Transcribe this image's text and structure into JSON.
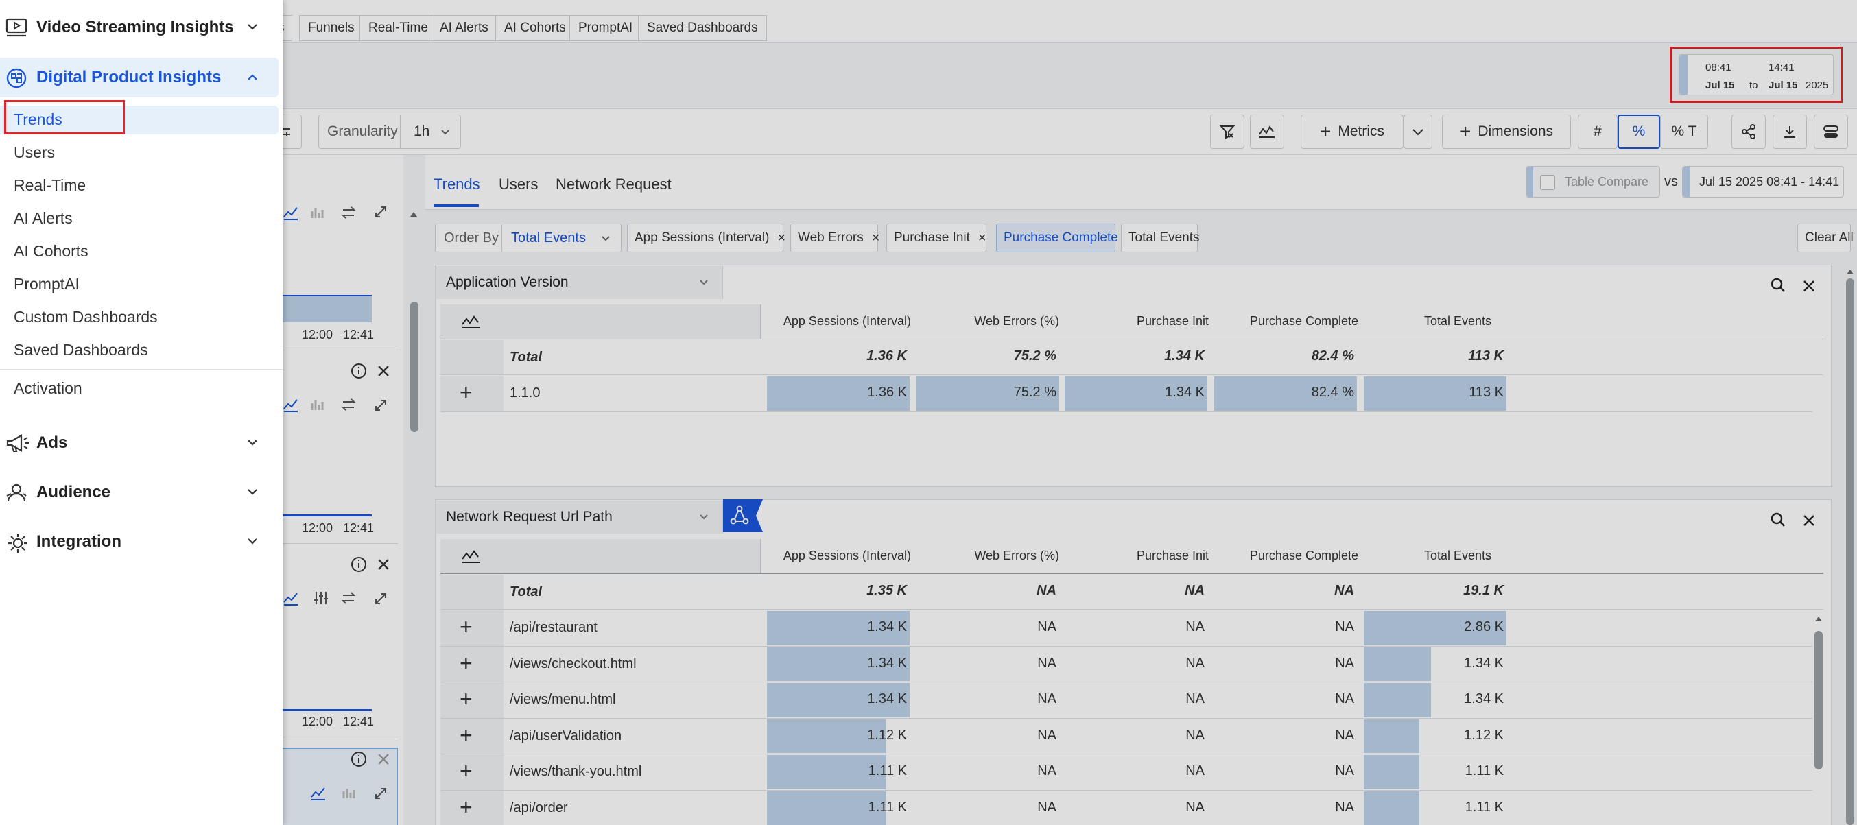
{
  "drawer": {
    "sections": [
      {
        "label": "Video Streaming Insights",
        "icon": "video-play-icon"
      },
      {
        "label": "Digital Product Insights",
        "icon": "digital-product-icon"
      },
      {
        "label": "Ads",
        "icon": "megaphone-icon"
      },
      {
        "label": "Audience",
        "icon": "audience-icon"
      },
      {
        "label": "Integration",
        "icon": "integration-gear-icon"
      }
    ],
    "items": [
      "Trends",
      "Users",
      "Real-Time",
      "AI Alerts",
      "AI Cohorts",
      "PromptAI",
      "Custom Dashboards",
      "Saved Dashboards"
    ],
    "activation": "Activation",
    "active_item": "Trends"
  },
  "top_nav": {
    "tabs": [
      "s",
      "Funnels",
      "Real-Time",
      "AI Alerts",
      "AI Cohorts",
      "PromptAI",
      "Saved Dashboards"
    ]
  },
  "date_range": {
    "start_time": "08:41",
    "end_time": "14:41",
    "start_date": "Jul 15",
    "to": "to",
    "end_date": "Jul 15",
    "year": "2025"
  },
  "toolbar": {
    "granularity_label": "Granularity",
    "granularity_value": "1h",
    "metrics_label": "Metrics",
    "dimensions_label": "Dimensions",
    "mode_count": "#",
    "mode_percent": "%",
    "mode_percent_total": "% T"
  },
  "left_cards": {
    "times": [
      "12:00",
      "12:41"
    ]
  },
  "subtabs": {
    "items": [
      "Trends",
      "Users",
      "Network Request"
    ],
    "active": "Trends",
    "table_compare": "Table Compare",
    "vs": "vs",
    "compare_range": "Jul 15 2025 08:41 - 14:41"
  },
  "filters": {
    "order_by_label": "Order By",
    "order_by_value": "Total Events",
    "chips": [
      "App Sessions (Interval)",
      "Web Errors",
      "Purchase Init",
      "Purchase Complete",
      "Total Events"
    ],
    "clear_all": "Clear All"
  },
  "columns": [
    "App Sessions (Interval)",
    "Web Errors (%)",
    "Purchase Init",
    "Purchase Complete",
    "Total Events"
  ],
  "sort_indicator": "↓",
  "panels": [
    {
      "dimension": "Application Version",
      "total_label": "Total",
      "totals": [
        "1.36 K",
        "75.2 %",
        "1.34 K",
        "82.4 %",
        "113 K"
      ],
      "rows": [
        {
          "label": "1.1.0",
          "values": [
            "1.36 K",
            "75.2 %",
            "1.34 K",
            "82.4 %",
            "113 K"
          ],
          "fill": [
            1,
            1,
            1,
            1,
            1
          ]
        }
      ]
    },
    {
      "dimension": "Network Request Url Path",
      "total_label": "Total",
      "totals": [
        "1.35 K",
        "NA",
        "NA",
        "NA",
        "19.1 K"
      ],
      "rows": [
        {
          "label": "/api/restaurant",
          "values": [
            "1.34 K",
            "NA",
            "NA",
            "NA",
            "2.86 K"
          ],
          "fill": [
            1,
            0,
            0,
            0,
            1
          ]
        },
        {
          "label": "/views/checkout.html",
          "values": [
            "1.34 K",
            "NA",
            "NA",
            "NA",
            "1.34 K"
          ],
          "fill": [
            1,
            0,
            0,
            0,
            0.47
          ]
        },
        {
          "label": "/views/menu.html",
          "values": [
            "1.34 K",
            "NA",
            "NA",
            "NA",
            "1.34 K"
          ],
          "fill": [
            1,
            0,
            0,
            0,
            0.47
          ]
        },
        {
          "label": "/api/userValidation",
          "values": [
            "1.12 K",
            "NA",
            "NA",
            "NA",
            "1.12 K"
          ],
          "fill": [
            0.83,
            0,
            0,
            0,
            0.39
          ]
        },
        {
          "label": "/views/thank-you.html",
          "values": [
            "1.11 K",
            "NA",
            "NA",
            "NA",
            "1.11 K"
          ],
          "fill": [
            0.83,
            0,
            0,
            0,
            0.39
          ]
        },
        {
          "label": "/api/order",
          "values": [
            "1.11 K",
            "NA",
            "NA",
            "NA",
            "1.11 K"
          ],
          "fill": [
            0.83,
            0,
            0,
            0,
            0.39
          ]
        }
      ]
    }
  ],
  "colors": {
    "accent": "#1a56db",
    "bar": "#bdd3ea",
    "highlight_border": "#e0242a",
    "active_item_bg": "#e6f0fb"
  }
}
